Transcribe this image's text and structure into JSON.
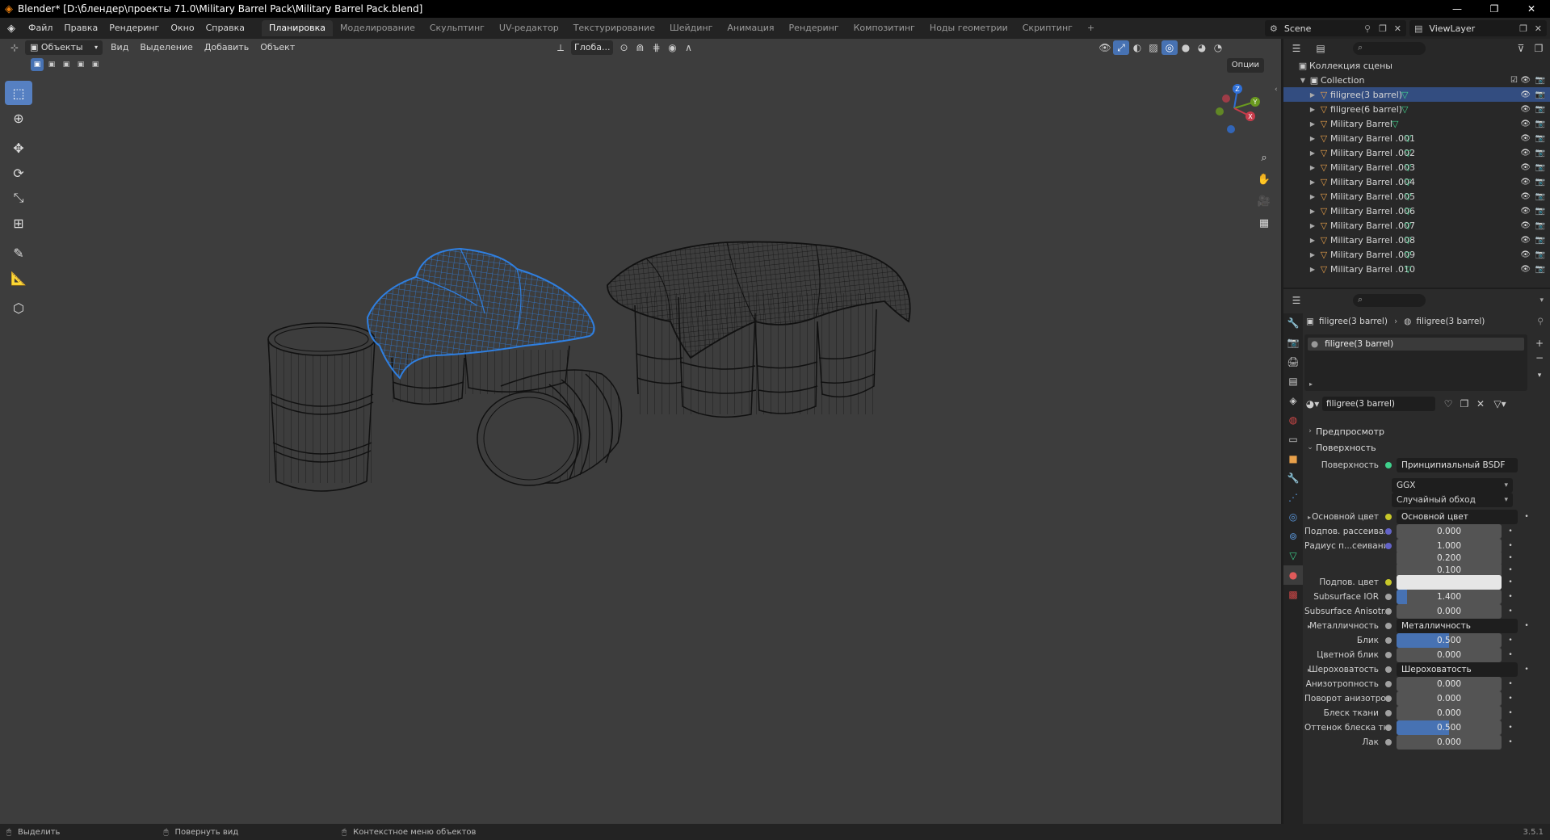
{
  "window": {
    "title": "Blender* [D:\\блендер\\проекты 71.0\\Military Barrel Pack\\Military Barrel Pack.blend]",
    "logo_icon": "blender-logo-icon"
  },
  "menu": [
    "Файл",
    "Правка",
    "Рендеринг",
    "Окно",
    "Справка"
  ],
  "workspaces": [
    "Планировка",
    "Моделирование",
    "Скульптинг",
    "UV-редактор",
    "Текстурирование",
    "Шейдинг",
    "Анимация",
    "Рендеринг",
    "Композитинг",
    "Ноды геометрии",
    "Скриптинг"
  ],
  "active_workspace": "Планировка",
  "scene": "Scene",
  "view_layer": "ViewLayer",
  "viewport": {
    "mode": "Объекты",
    "menus": [
      "Вид",
      "Выделение",
      "Добавить",
      "Объект"
    ],
    "transform_orientation": "Глоба...",
    "options_label": "Опции",
    "gizmo_axes": [
      "X",
      "Y",
      "Z"
    ]
  },
  "statusbar": [
    "Выделить",
    "Повернуть вид",
    "Контекстное меню объектов"
  ],
  "version": "3.5.1",
  "outliner": {
    "root": "Коллекция сцены",
    "collection": "Collection",
    "objects": [
      "filigree(3 barrel)",
      "filigree(6 barrel)",
      "Military Barrel",
      "Military Barrel .001",
      "Military Barrel .002",
      "Military Barrel .003",
      "Military Barrel .004",
      "Military Barrel .005",
      "Military Barrel .006",
      "Military Barrel .007",
      "Military Barrel .008",
      "Military Barrel .009",
      "Military Barrel .010"
    ],
    "selected": "filigree(3 barrel)"
  },
  "properties": {
    "breadcrumb_object": "filigree(3 barrel)",
    "breadcrumb_material": "filigree(3 barrel)",
    "slot": "filigree(3 barrel)",
    "material_name": "filigree(3 barrel)",
    "preview_label": "Предпросмотр",
    "surface_panel": "Поверхность",
    "surface_label": "Поверхность",
    "surface_value": "Принципиальный BSDF",
    "distribution": "GGX",
    "subsurface_method": "Случайный обход",
    "fields": [
      {
        "label": "Основной цвет",
        "value": "Основной цвет",
        "type": "link",
        "dot": "#c7c729",
        "expand": true
      },
      {
        "label": "Подпов. рассеива...",
        "value": "0.000",
        "type": "num",
        "dot": "#6363c7",
        "fill": 0
      },
      {
        "label": "Радиус п...сеивания",
        "value": "1.000",
        "type": "num",
        "dot": "#6363c7",
        "fill": 0
      },
      {
        "label": "",
        "value": "0.200",
        "type": "num",
        "dot": "",
        "fill": 0
      },
      {
        "label": "",
        "value": "0.100",
        "type": "num",
        "dot": "",
        "fill": 0
      },
      {
        "label": "Подпов. цвет",
        "value": "",
        "type": "color",
        "dot": "#c7c729",
        "color": "#e6e6e6"
      },
      {
        "label": "Subsurface IOR",
        "value": "1.400",
        "type": "num",
        "dot": "#a1a1a1",
        "fill": 0.1
      },
      {
        "label": "Subsurface Anisotr...",
        "value": "0.000",
        "type": "num",
        "dot": "#a1a1a1",
        "fill": 0
      },
      {
        "label": "Металличность",
        "value": "Металличность",
        "type": "link",
        "dot": "#a1a1a1",
        "expand": true
      },
      {
        "label": "Блик",
        "value": "0.500",
        "type": "num",
        "dot": "#a1a1a1",
        "fill": 0.5
      },
      {
        "label": "Цветной блик",
        "value": "0.000",
        "type": "num",
        "dot": "#a1a1a1",
        "fill": 0
      },
      {
        "label": "Шероховатость",
        "value": "Шероховатость",
        "type": "link",
        "dot": "#a1a1a1",
        "expand": true
      },
      {
        "label": "Анизотропность",
        "value": "0.000",
        "type": "num",
        "dot": "#a1a1a1",
        "fill": 0
      },
      {
        "label": "Поворот анизотро...",
        "value": "0.000",
        "type": "num",
        "dot": "#a1a1a1",
        "fill": 0
      },
      {
        "label": "Блеск ткани",
        "value": "0.000",
        "type": "num",
        "dot": "#a1a1a1",
        "fill": 0
      },
      {
        "label": "Оттенок блеска тк...",
        "value": "0.500",
        "type": "num",
        "dot": "#a1a1a1",
        "fill": 0.5
      },
      {
        "label": "Лак",
        "value": "0.000",
        "type": "num",
        "dot": "#a1a1a1",
        "fill": 0
      }
    ]
  },
  "colors": {
    "accent": "#4772b3",
    "selected_wire": "#2f7fe0",
    "wire": "#0c0c0c",
    "viewport_bg": "#3d3d3d"
  }
}
